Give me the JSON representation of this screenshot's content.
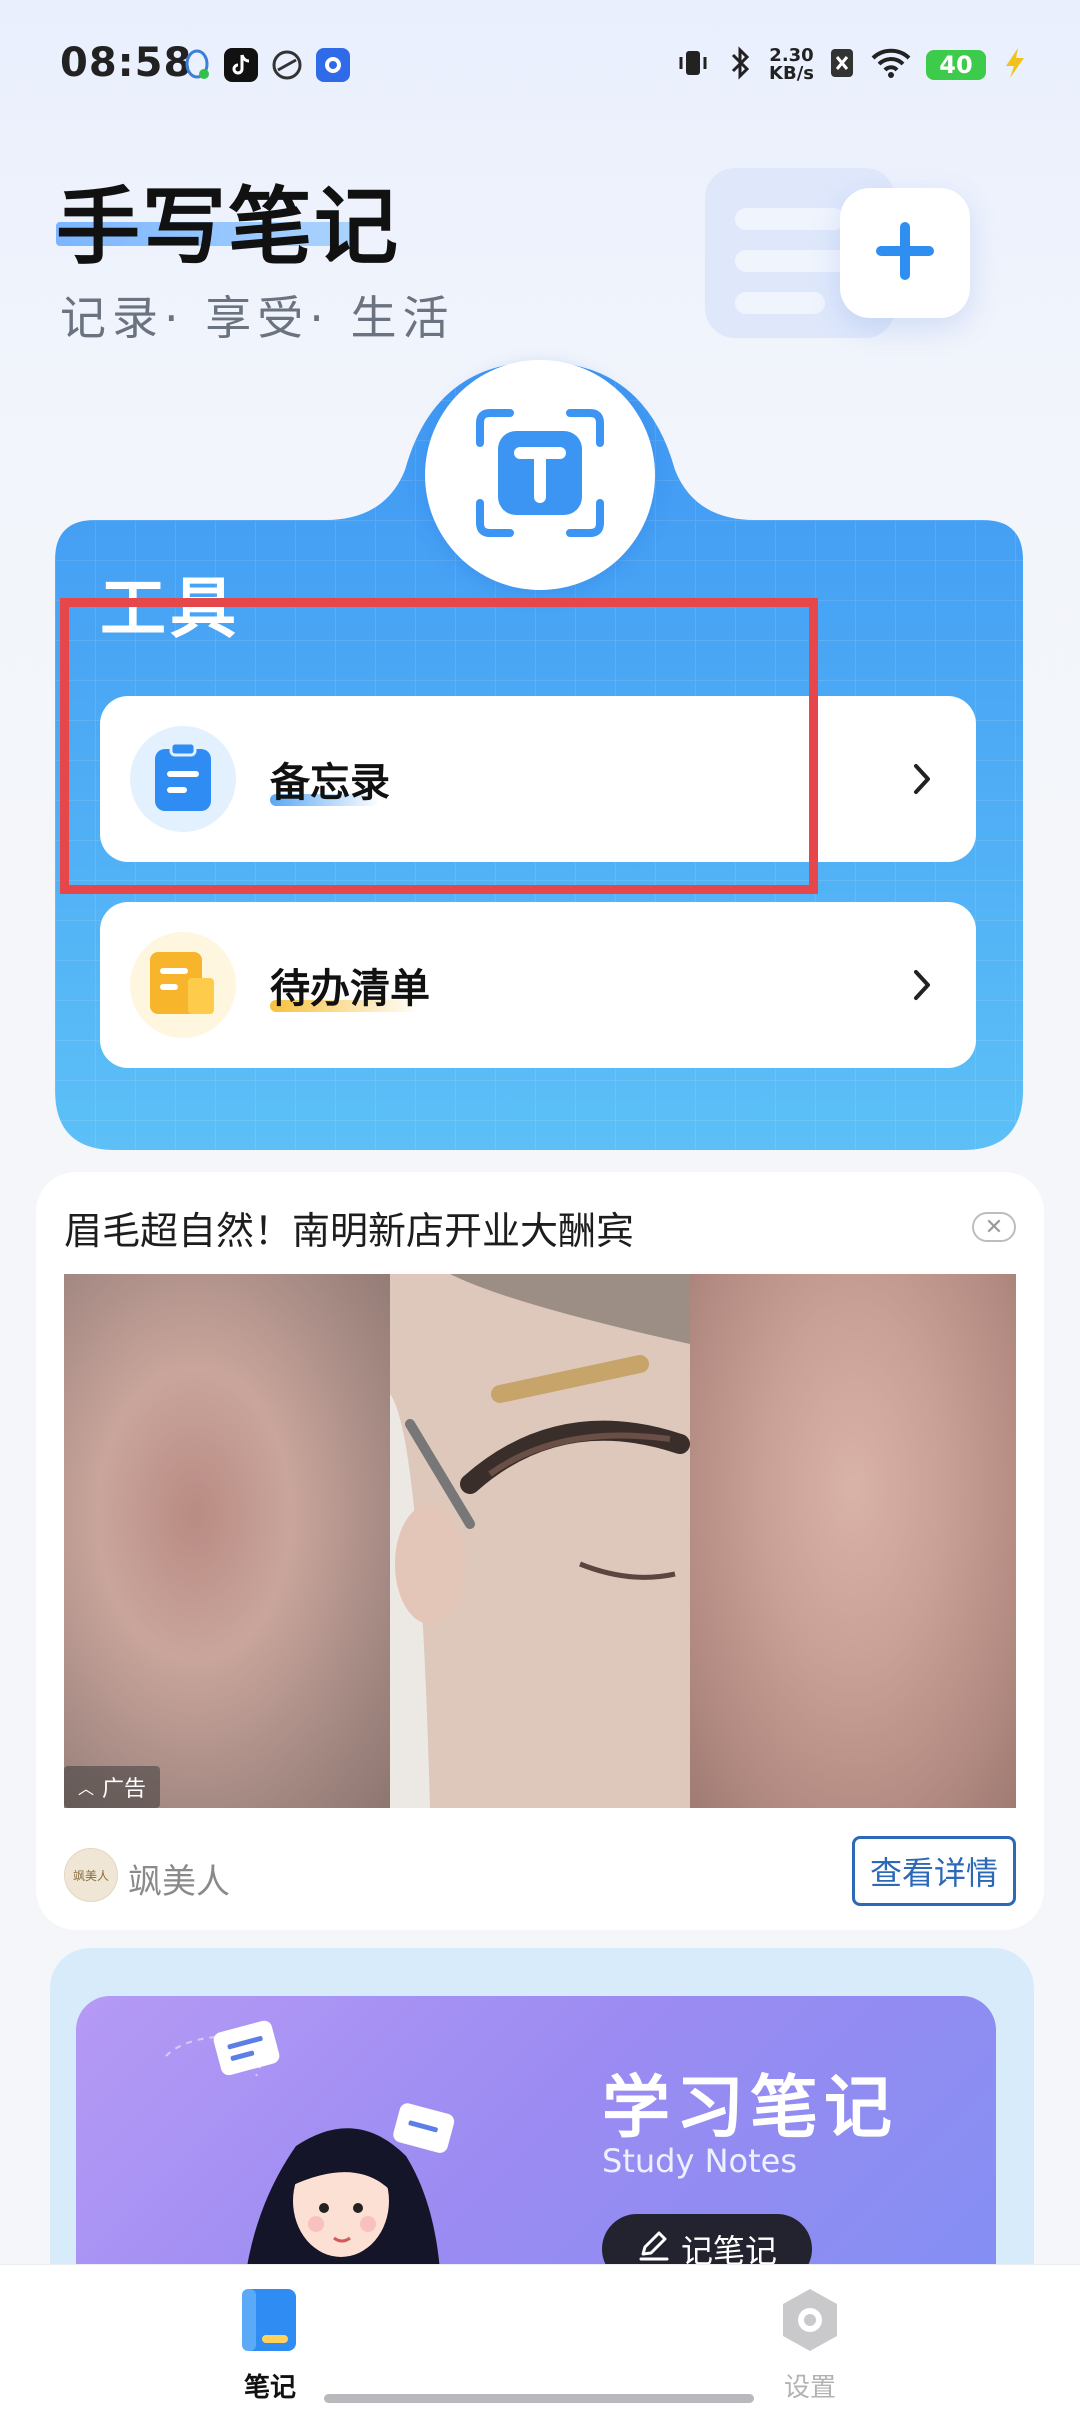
{
  "status_bar": {
    "time": "08:58",
    "net_speed_value": "2.30",
    "net_speed_unit": "KB/s",
    "battery": "40"
  },
  "header": {
    "title": "手写笔记",
    "subtitle": "记录· 享受· 生活"
  },
  "tools": {
    "title": "工具",
    "items": [
      {
        "label": "备忘录",
        "icon": "memo-icon",
        "color": "#2f8cf3"
      },
      {
        "label": "待办清单",
        "icon": "todo-list-icon",
        "color": "#f7b52c"
      }
    ]
  },
  "ad": {
    "title": "眉毛超自然！南明新店开业大酬宾",
    "tag": "广告",
    "brand": "飒美人",
    "logo_text": "飒美人",
    "detail_button": "查看详情"
  },
  "study_banner": {
    "title": "学习笔记",
    "subtitle": "Study Notes",
    "button_label": "记笔记"
  },
  "bottom_nav": {
    "tabs": [
      {
        "label": "笔记",
        "active": true
      },
      {
        "label": "设置",
        "active": false
      }
    ]
  },
  "colors": {
    "accent_blue": "#4aa3f6",
    "highlight_red": "#e5474a",
    "link_blue": "#2c69b6"
  }
}
